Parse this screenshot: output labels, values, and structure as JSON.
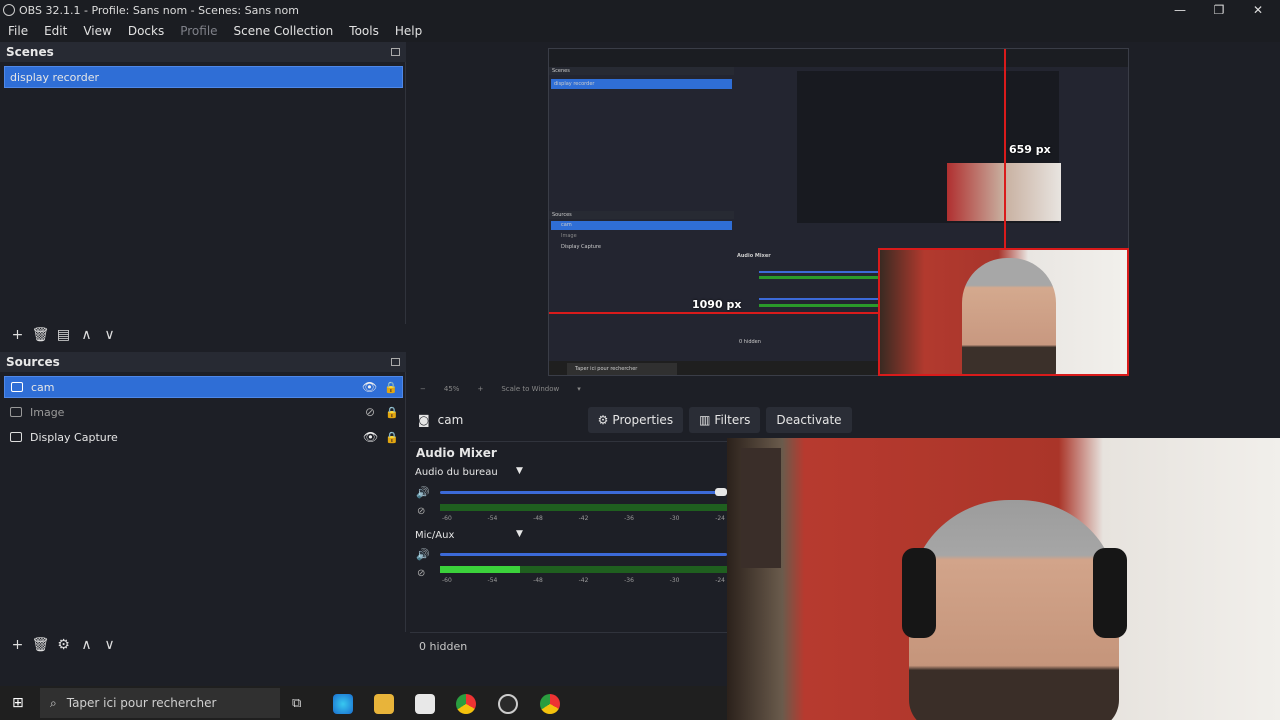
{
  "window": {
    "title": "OBS 32.1.1 - Profile: Sans nom - Scenes: Sans nom",
    "controls": [
      "minimize-icon",
      "maximize-icon",
      "close-icon"
    ]
  },
  "menu": {
    "items": [
      "File",
      "Edit",
      "View",
      "Docks",
      "Profile",
      "Scene Collection",
      "Tools",
      "Help"
    ],
    "disabled": [
      "Profile"
    ]
  },
  "scenes": {
    "title": "Scenes",
    "items": [
      {
        "label": "display recorder",
        "selected": true
      }
    ]
  },
  "sources": {
    "title": "Sources",
    "items": [
      {
        "label": "cam",
        "selected": true,
        "visible": true,
        "icon": "camera-icon"
      },
      {
        "label": "Image",
        "selected": false,
        "visible": false,
        "icon": "image-icon"
      },
      {
        "label": "Display Capture",
        "selected": false,
        "visible": true,
        "icon": "monitor-icon"
      }
    ]
  },
  "preview": {
    "width_label": "1090 px",
    "height_label": "659 px",
    "zoom": "45%",
    "scale_mode": "Scale to Window",
    "nested": {
      "scenes_title": "Scenes",
      "sources_title": "Sources",
      "scene_item": "display recorder",
      "sources": [
        "cam",
        "Image",
        "Display Capture"
      ],
      "audio_title": "Audio Mixer",
      "hidden": "0 hidden",
      "search": "Taper ici pour rechercher"
    }
  },
  "context": {
    "source_name": "cam",
    "properties_label": "Properties",
    "filters_label": "Filters",
    "deactivate_label": "Deactivate"
  },
  "mixer": {
    "title": "Audio Mixer",
    "channels": [
      {
        "name": "Audio du bureau",
        "volume": 1.0,
        "level": 0.0
      },
      {
        "name": "Mic/Aux",
        "volume": 1.0,
        "level": 0.28
      }
    ],
    "scale": [
      "-60",
      "-54",
      "-48",
      "-42",
      "-36",
      "-30",
      "-24"
    ],
    "hidden_label": "0 hidden"
  },
  "taskbar": {
    "search_placeholder": "Taper ici pour rechercher"
  },
  "colors": {
    "accent": "#2f6ed6",
    "selection_border": "#d91b1b",
    "meter_green": "#3bd13b"
  }
}
